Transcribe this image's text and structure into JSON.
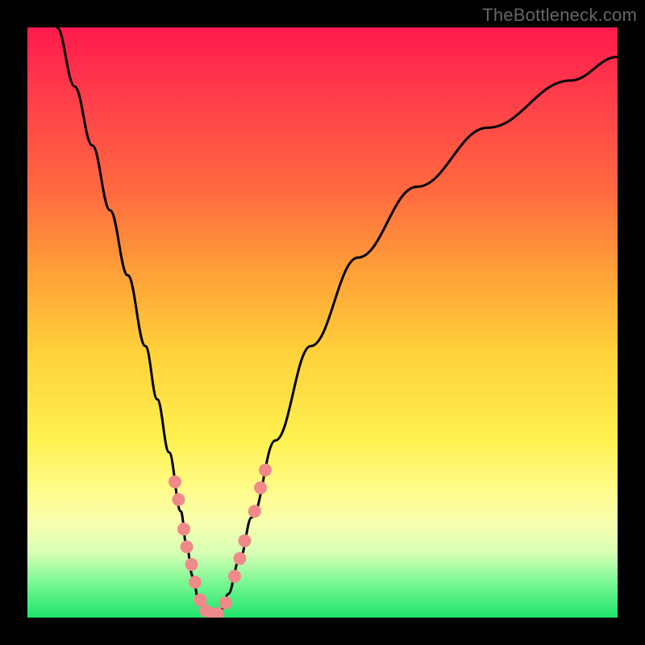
{
  "watermark": "TheBottleneck.com",
  "colors": {
    "frame": "#000000",
    "curve": "#000000",
    "marker_fill": "#f08a8a",
    "marker_stroke": "#e06a6a"
  },
  "chart_data": {
    "type": "line",
    "title": "",
    "xlabel": "",
    "ylabel": "",
    "xlim": [
      0,
      100
    ],
    "ylim": [
      0,
      100
    ],
    "grid": false,
    "series": [
      {
        "name": "bottleneck-curve",
        "x": [
          5,
          8,
          11,
          14,
          17,
          20,
          22,
          24,
          26,
          27,
          28,
          29,
          30,
          31,
          32,
          33,
          34,
          36,
          38,
          42,
          48,
          56,
          66,
          78,
          92,
          100
        ],
        "values": [
          100,
          90,
          80,
          69,
          58,
          46,
          37,
          28,
          18,
          12,
          7,
          3,
          1,
          0.3,
          0.4,
          1.5,
          4,
          10,
          17,
          30,
          46,
          61,
          73,
          83,
          91,
          95
        ]
      }
    ],
    "markers": [
      {
        "x": 25.0,
        "y": 23
      },
      {
        "x": 25.6,
        "y": 20
      },
      {
        "x": 26.5,
        "y": 15
      },
      {
        "x": 27.0,
        "y": 12
      },
      {
        "x": 27.8,
        "y": 9
      },
      {
        "x": 28.4,
        "y": 6
      },
      {
        "x": 29.3,
        "y": 3
      },
      {
        "x": 30.2,
        "y": 1.2
      },
      {
        "x": 31.5,
        "y": 0.5
      },
      {
        "x": 32.2,
        "y": 0.7
      },
      {
        "x": 33.6,
        "y": 2.5
      },
      {
        "x": 35.1,
        "y": 7
      },
      {
        "x": 36.0,
        "y": 10
      },
      {
        "x": 36.8,
        "y": 13
      },
      {
        "x": 38.5,
        "y": 18
      },
      {
        "x": 39.5,
        "y": 22
      },
      {
        "x": 40.3,
        "y": 25
      }
    ],
    "annotations": []
  }
}
